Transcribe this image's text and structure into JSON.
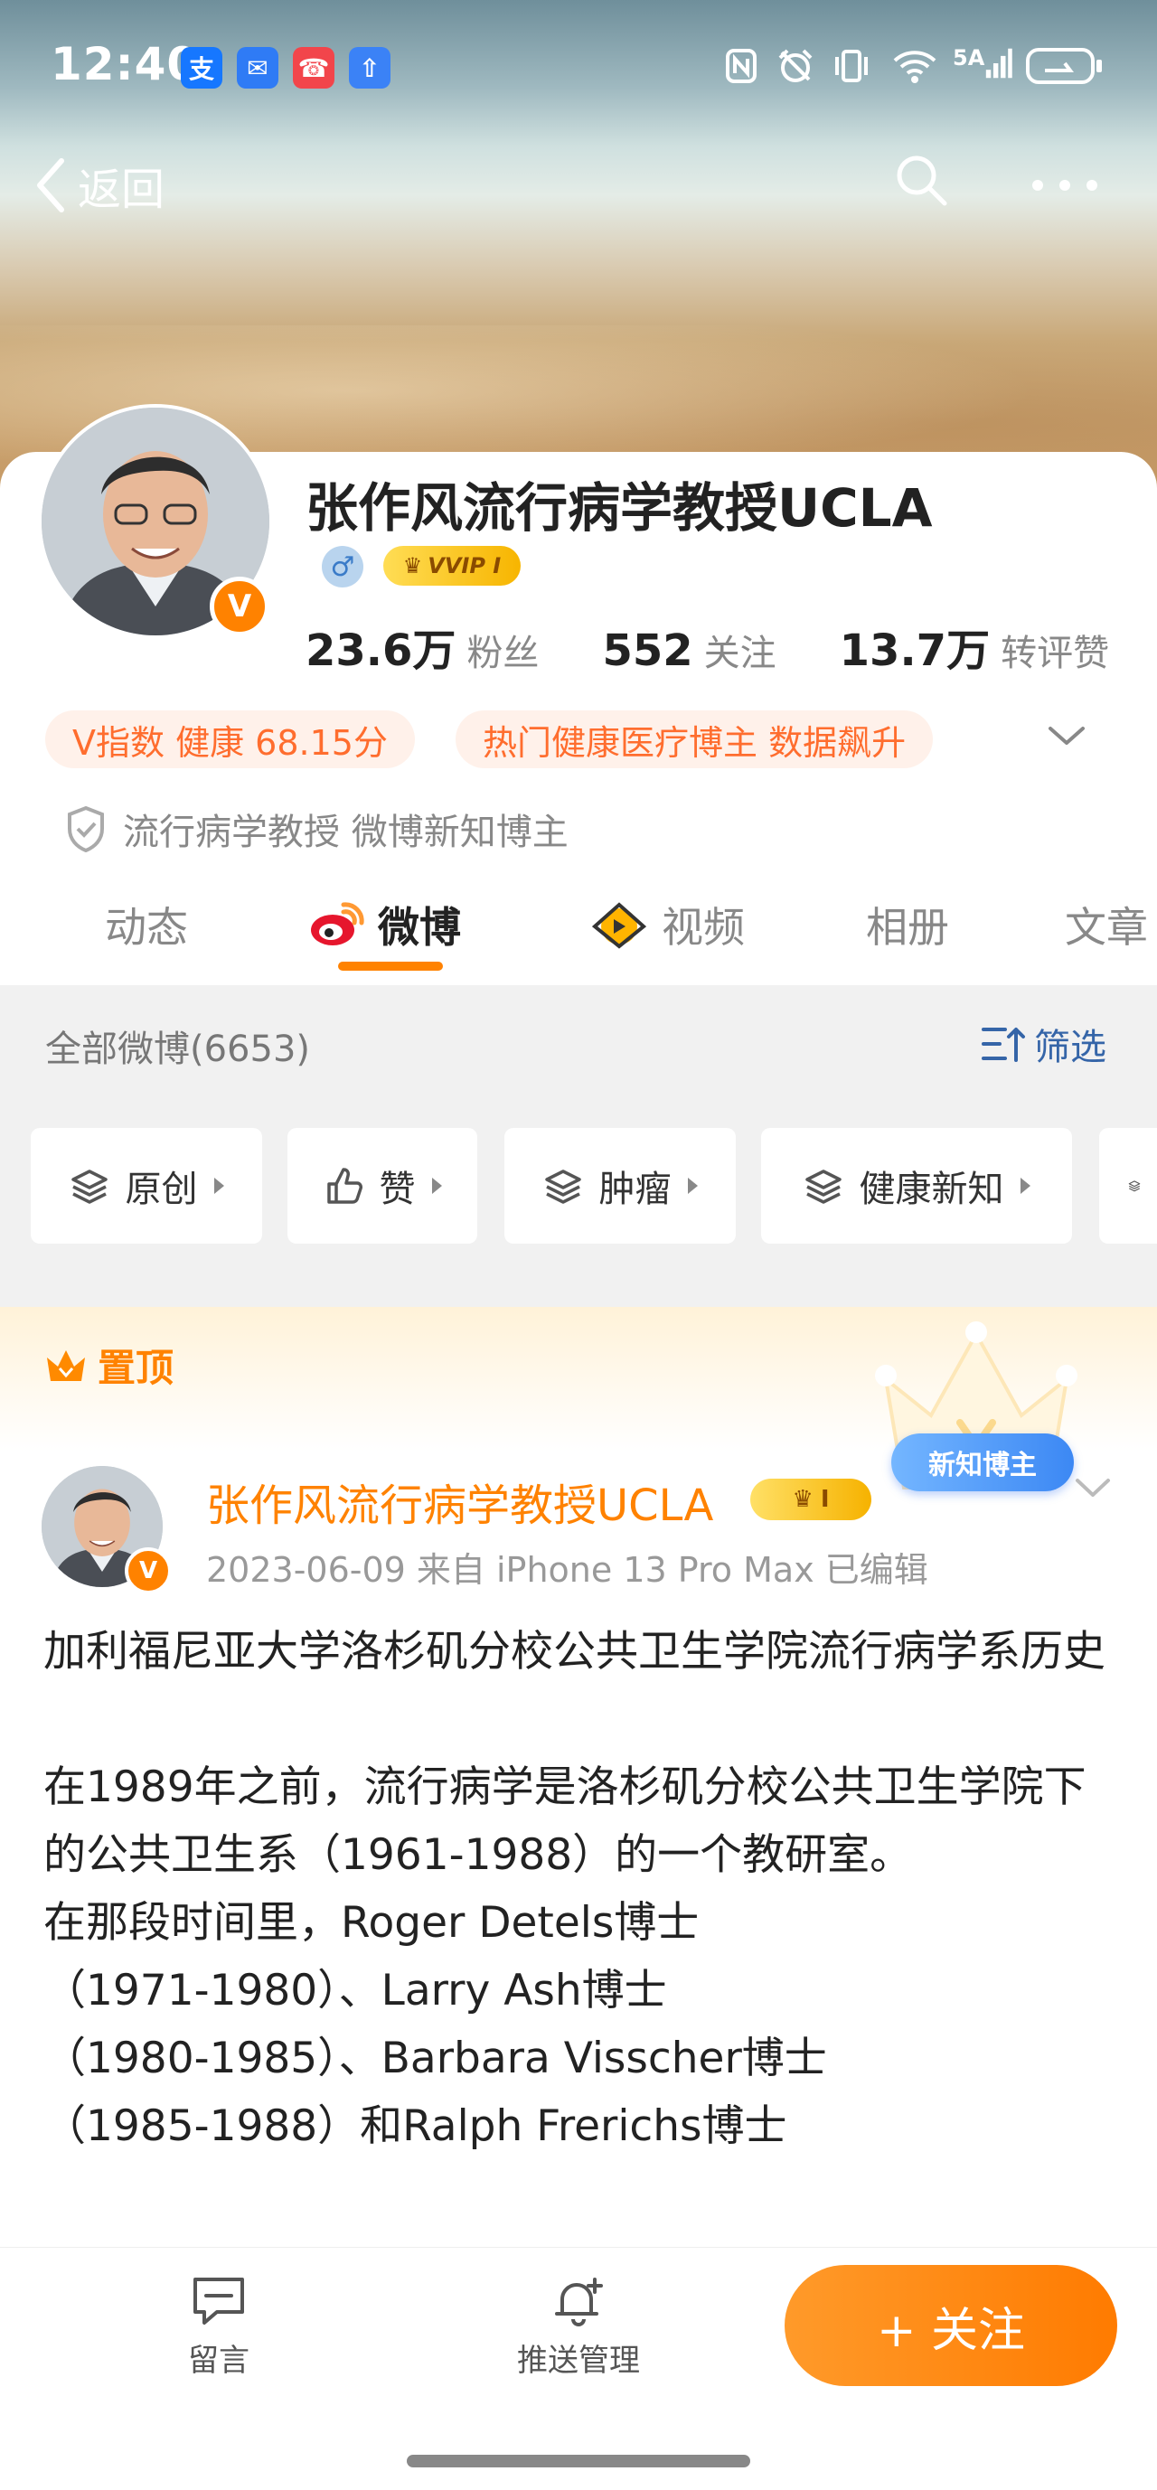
{
  "status": {
    "time": "12:40",
    "apps": [
      {
        "glyph": "支",
        "color": "#1677ff"
      },
      {
        "glyph": "✉",
        "color": "#2f7bf5"
      },
      {
        "glyph": "☎",
        "color": "#f2454b"
      },
      {
        "glyph": "⇧",
        "color": "#3b82f6"
      }
    ],
    "network": "5A"
  },
  "nav": {
    "back_label": "返回"
  },
  "profile": {
    "name": "张作风流行病学教授UCLA",
    "vbadge": "V",
    "gender": "♂",
    "vip_label": "VVIP I",
    "stats": [
      {
        "value": "23.6万",
        "label": "粉丝"
      },
      {
        "value": "552",
        "label": "关注"
      },
      {
        "value": "13.7万",
        "label": "转评赞"
      }
    ],
    "chips": [
      "V指数 健康 68.15分",
      "热门健康医疗博主 数据飙升"
    ],
    "verification": "流行病学教授 微博新知博主"
  },
  "tabs": [
    "动态",
    "微博",
    "视频",
    "相册",
    "文章"
  ],
  "feed": {
    "count_label": "全部微博(6653)",
    "filter_label": "筛选",
    "filters": [
      "原创",
      "赞",
      "肿瘤",
      "健康新知",
      ""
    ]
  },
  "pinned": {
    "label": "置顶",
    "badge": "新知博主"
  },
  "post": {
    "author": "张作风流行病学教授UCLA",
    "level_badge": "I",
    "vbadge": "V",
    "meta": "2023-06-09  来自 iPhone 13 Pro Max  已编辑",
    "body": "加利福尼亚大学洛杉矶分校公共卫生学院流行病学系历史\n\n在1989年之前，流行病学是洛杉矶分校公共卫生学院下的公共卫生系（1961-1988）的一个教研室。\n在那段时间里，Roger Detels博士\n（1971-1980）、Larry Ash博士\n（1980-1985）、Barbara Visscher博士\n（1985-1988）和Ralph Frerichs博士"
  },
  "bottom": {
    "comment_label": "留言",
    "push_label": "推送管理",
    "follow_label": "+ 关注"
  },
  "colors": {
    "accent": "#ff8200",
    "link": "#3565a8",
    "chip_bg": "#fff1ea",
    "chip_text": "#ff6d2e"
  }
}
